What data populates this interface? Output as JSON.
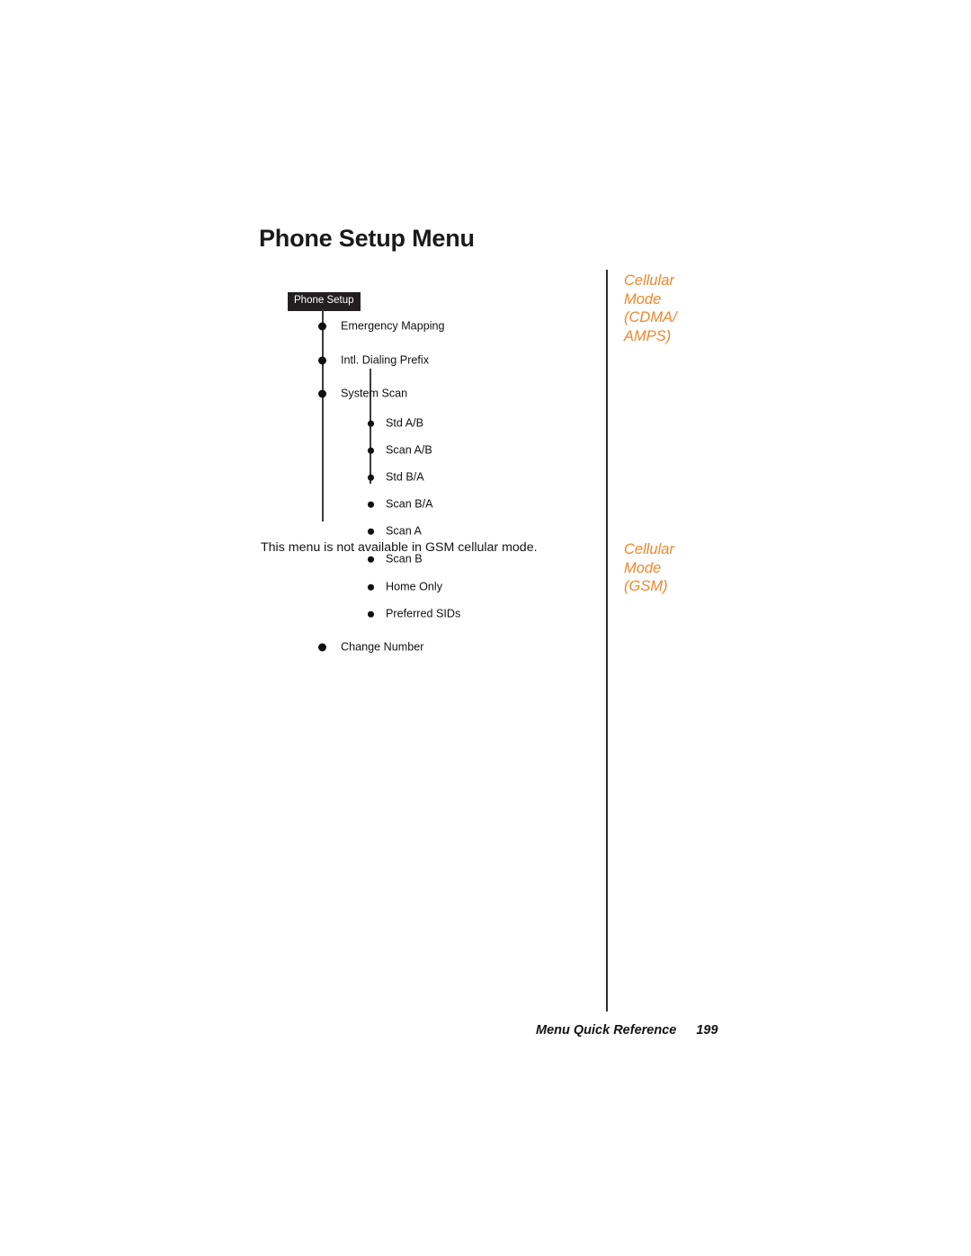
{
  "page": {
    "title": "Phone Setup Menu",
    "body_note": "This menu is not available in GSM cellular mode.",
    "accent_color": "#F5852A",
    "label_box_color": "#231F20"
  },
  "menu_tree": {
    "root_label": "Phone Setup",
    "items": [
      {
        "label": "Emergency Mapping",
        "level": 1
      },
      {
        "label": "Intl. Dialing Prefix",
        "level": 1
      },
      {
        "label": "System Scan",
        "level": 1
      },
      {
        "label": "Std A/B",
        "level": 2
      },
      {
        "label": "Scan A/B",
        "level": 2
      },
      {
        "label": "Std B/A",
        "level": 2
      },
      {
        "label": "Scan B/A",
        "level": 2
      },
      {
        "label": "Scan A",
        "level": 2
      },
      {
        "label": "Scan B",
        "level": 2
      },
      {
        "label": "Home Only",
        "level": 2
      },
      {
        "label": "Preferred SIDs",
        "level": 2
      },
      {
        "label": "Change Number",
        "level": 1
      }
    ]
  },
  "margin_notes": [
    {
      "lines": [
        "Cellular",
        "Mode",
        "(CDMA/",
        "AMPS)"
      ]
    },
    {
      "lines": [
        "Cellular",
        "Mode",
        "(GSM)"
      ]
    }
  ],
  "footer": {
    "section": "Menu Quick Reference",
    "page_number": "199"
  }
}
